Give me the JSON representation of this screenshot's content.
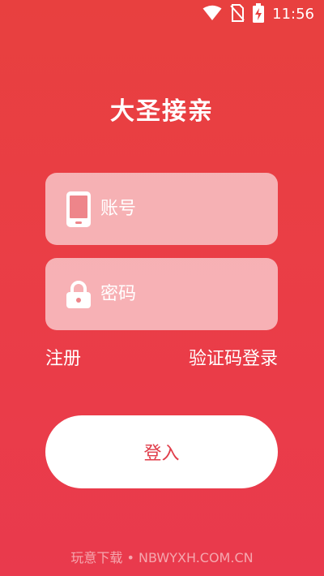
{
  "status_bar": {
    "time": "11:56",
    "icons": [
      "wifi-icon",
      "no-sim-icon",
      "battery-charging-icon"
    ]
  },
  "app": {
    "title": "大圣接亲"
  },
  "form": {
    "account_placeholder": "账号",
    "account_icon": "phone-icon",
    "password_placeholder": "密码",
    "password_icon": "lock-icon"
  },
  "links": {
    "register": "注册",
    "code_login": "验证码登录"
  },
  "login_button": {
    "label": "登入"
  },
  "watermark": {
    "text": "玩意下载 • NBWYXH.COM.CN"
  },
  "colors": {
    "background_top": "#e8403f",
    "background_bottom": "#e93a4d",
    "accent_text": "#e03c49",
    "field_bg": "rgba(255,255,255,0.6)"
  }
}
